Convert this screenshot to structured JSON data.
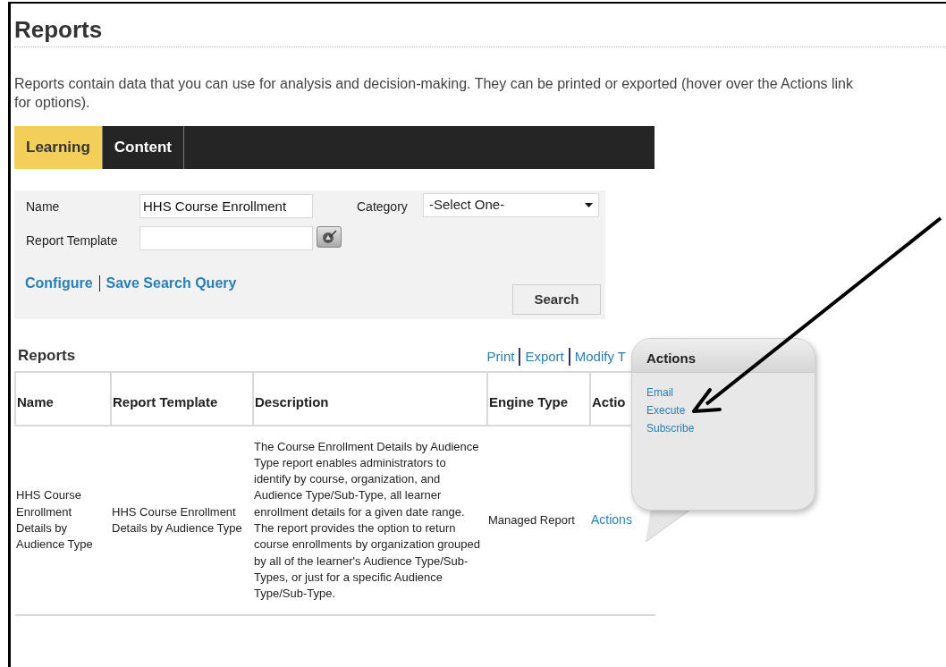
{
  "page": {
    "title": "Reports",
    "intro": "Reports contain data that you can use for analysis and decision-making. They can be printed or exported (hover over the Actions link for options)."
  },
  "tabs": [
    {
      "label": "Learning",
      "selected": true
    },
    {
      "label": "Content",
      "selected": false
    }
  ],
  "search": {
    "name_label": "Name",
    "name_value": "HHS Course Enrollment",
    "category_label": "Category",
    "category_value": "-Select One-",
    "template_label": "Report Template",
    "links": [
      "Configure",
      "Save Search Query"
    ],
    "button": "Search"
  },
  "results": {
    "title": "Reports",
    "links": [
      "Print",
      "Export",
      "Modify T"
    ],
    "columns": [
      "Name",
      "Report Template",
      "Description",
      "Engine Type",
      "Actio"
    ],
    "rows": [
      {
        "name": "HHS Course Enrollment Details by Audience Type",
        "template": "HHS Course Enrollment Details by Audience Type",
        "description": "The Course Enrollment Details by Audience Type report enables administrators to identify by course, organization, and Audience Type/Sub-Type, all learner enrollment details for a given date range. The report provides the option to return course enrollments by organization grouped by all of the learner's Audience Type/Sub-Types, or just for a specific Audience Type/Sub-Type.",
        "engine": "Managed Report",
        "action": "Actions"
      }
    ]
  },
  "popover": {
    "title": "Actions",
    "items": [
      "Email",
      "Execute",
      "Subscribe"
    ]
  }
}
